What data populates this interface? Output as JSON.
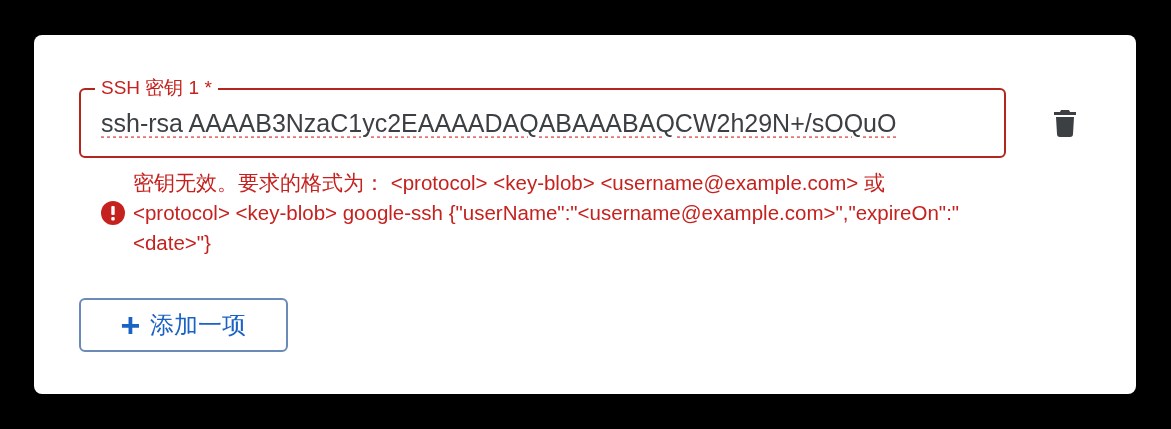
{
  "field": {
    "label": "SSH 密钥 1 *",
    "value": "ssh-rsa AAAAB3NzaC1yc2EAAAADAQABAAABAQCW2h29N+/sOQuO",
    "invalid": true,
    "error": "密钥无效。要求的格式为： <protocol> <key-blob> <username@example.com> 或 <protocol> <key-blob> google-ssh {\"userName\":\"<username@example.com>\",\"expireOn\":\"<date>\"}"
  },
  "add_button": {
    "icon": "+",
    "label": "添加一项"
  }
}
